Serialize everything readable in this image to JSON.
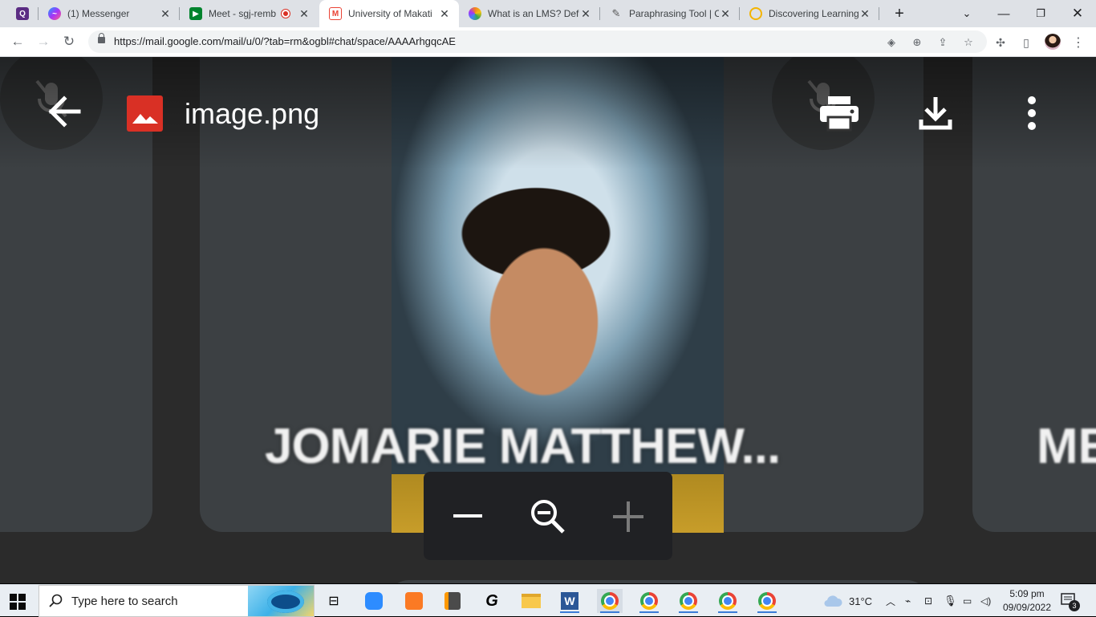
{
  "browser": {
    "tabs": [
      {
        "title": "",
        "favicon": "q-app-icon",
        "color": "#5b2c83"
      },
      {
        "title": "(1) Messenger",
        "favicon": "messenger-icon",
        "color": "#a334fa"
      },
      {
        "title": "Meet - sgj-remb",
        "favicon": "google-meet-icon",
        "color": "#00832d"
      },
      {
        "title": "University of Makati",
        "favicon": "gmail-icon",
        "color": "#ea4335"
      },
      {
        "title": "What is an LMS? Defi",
        "favicon": "lms-icon",
        "color": "#f48120"
      },
      {
        "title": "Paraphrasing Tool | C",
        "favicon": "quill-icon",
        "color": "#555555"
      },
      {
        "title": "Discovering Learning",
        "favicon": "learning-icon",
        "color": "#f4b400"
      }
    ],
    "url": "https://mail.google.com/mail/u/0/?tab=rm&ogbl#chat/space/AAAArhgqcAE"
  },
  "viewer": {
    "file_name": "image.png",
    "participant_name": "JOMARIE MATTHEW...",
    "participant_name_partial": "ME"
  },
  "taskbar": {
    "search_placeholder": "Type here to search",
    "weather": "31°C",
    "time": "5:09 pm",
    "date": "09/09/2022",
    "notification_count": "3"
  }
}
